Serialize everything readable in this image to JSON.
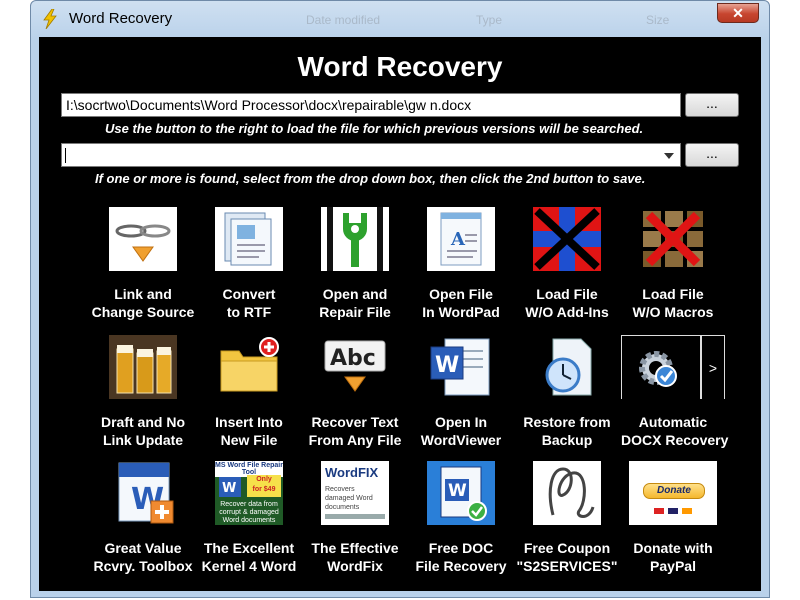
{
  "window": {
    "title": "Word Recovery",
    "close_glyph": "✕",
    "background_columns": [
      "Date modified",
      "Type",
      "Size"
    ]
  },
  "header": "Word Recovery",
  "file_input": {
    "value": "I:\\socrtwo\\Documents\\Word Processor\\docx\\repairable\\gw n.docx",
    "button_label": "...",
    "hint": "Use the button to the right to load the file for which previous versions will be searched."
  },
  "versions": {
    "value": "",
    "button_label": "...",
    "hint": "If one or more is found, select from the drop down box, then click the 2nd button to save."
  },
  "tiles": [
    {
      "line1": "Link and",
      "line2": "Change Source",
      "icon": "chain-link-icon"
    },
    {
      "line1": "Convert",
      "line2": "to RTF",
      "icon": "document-convert-icon"
    },
    {
      "line1": "Open and",
      "line2": "Repair File",
      "icon": "wrench-icon"
    },
    {
      "line1": "Open File",
      "line2": "In WordPad",
      "icon": "wordpad-icon"
    },
    {
      "line1": "Load File",
      "line2": "W/O Add-Ins",
      "icon": "no-addins-icon"
    },
    {
      "line1": "Load File",
      "line2": "W/O Macros",
      "icon": "no-macros-icon"
    },
    {
      "line1": "Draft and No",
      "line2": "Link Update",
      "icon": "beer-draft-icon"
    },
    {
      "line1": "Insert Into",
      "line2": "New File",
      "icon": "folder-add-icon"
    },
    {
      "line1": "Recover Text",
      "line2": "From Any File",
      "icon": "abc-text-icon"
    },
    {
      "line1": "Open In",
      "line2": "WordViewer",
      "icon": "word-viewer-icon"
    },
    {
      "line1": "Restore from",
      "line2": "Backup",
      "icon": "backup-clock-icon"
    },
    {
      "line1": "Automatic",
      "line2": "DOCX Recovery",
      "icon": "gear-check-icon",
      "next_label": ">"
    },
    {
      "line1": "Great Value",
      "line2": "Rcvry. Toolbox",
      "icon": "word-toolbox-icon"
    },
    {
      "line1": "The Excellent",
      "line2": "Kernel 4 Word",
      "icon": "kernel-ad-icon",
      "ad": {
        "title": "MS Word File Repair Tool",
        "price_line1": "Only",
        "price_line2": "for $49",
        "body": "Recover data from corrupt & damaged Word documents"
      }
    },
    {
      "line1": "The Effective",
      "line2": "WordFix",
      "icon": "wordfix-icon",
      "ad": {
        "title": "WordFIX",
        "body": "Recovers damaged Word documents"
      }
    },
    {
      "line1": "Free DOC",
      "line2": "File Recovery",
      "icon": "word-doc-recovery-icon"
    },
    {
      "line1": "Free Coupon",
      "line2": "\"S2SERVICES\"",
      "icon": "coupon-squiggle-icon"
    },
    {
      "line1": "Donate with",
      "line2": "PayPal",
      "icon": "paypal-donate-icon",
      "ad": {
        "button": "Donate"
      }
    }
  ],
  "colors": {
    "window_frame": "#b9d1ea",
    "client": "#000000",
    "text": "#ffffff",
    "close": "#c7452f"
  }
}
